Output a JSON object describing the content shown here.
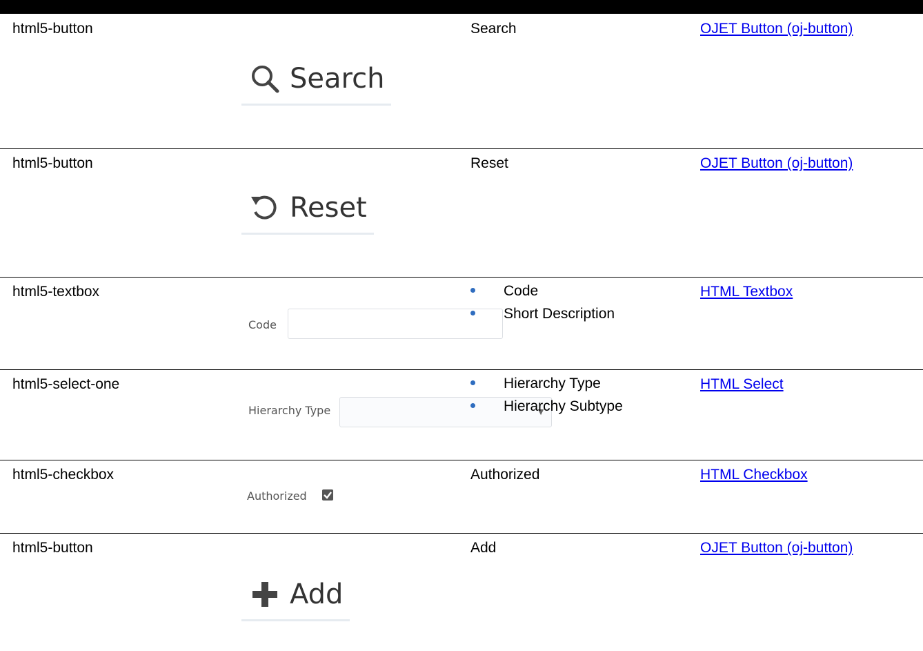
{
  "rows": [
    {
      "component": "html5-button",
      "preview": {
        "label": "Search",
        "icon": "search-icon"
      },
      "properties": [
        "Search"
      ],
      "reference": "OJET Button (oj-button)"
    },
    {
      "component": "html5-button",
      "preview": {
        "label": "Reset",
        "icon": "reset-icon"
      },
      "properties": [
        "Reset"
      ],
      "reference": "OJET Button (oj-button)"
    },
    {
      "component": "html5-textbox",
      "preview": {
        "label": "Code"
      },
      "properties": [
        "Code",
        "Short Description"
      ],
      "reference": "HTML Textbox"
    },
    {
      "component": "html5-select-one",
      "preview": {
        "label": "Hierarchy Type"
      },
      "properties": [
        "Hierarchy Type",
        "Hierarchy Subtype"
      ],
      "reference": "HTML Select"
    },
    {
      "component": "html5-checkbox",
      "preview": {
        "label": "Authorized",
        "checked": true
      },
      "properties": [
        "Authorized"
      ],
      "reference": "HTML Checkbox"
    },
    {
      "component": "html5-button",
      "preview": {
        "label": "Add",
        "icon": "plus-icon"
      },
      "properties": [
        "Add"
      ],
      "reference": "OJET Button (oj-button)"
    }
  ],
  "colors": {
    "link": "#0000ee",
    "bullet": "#2f6dbf",
    "rule": "#000000"
  }
}
